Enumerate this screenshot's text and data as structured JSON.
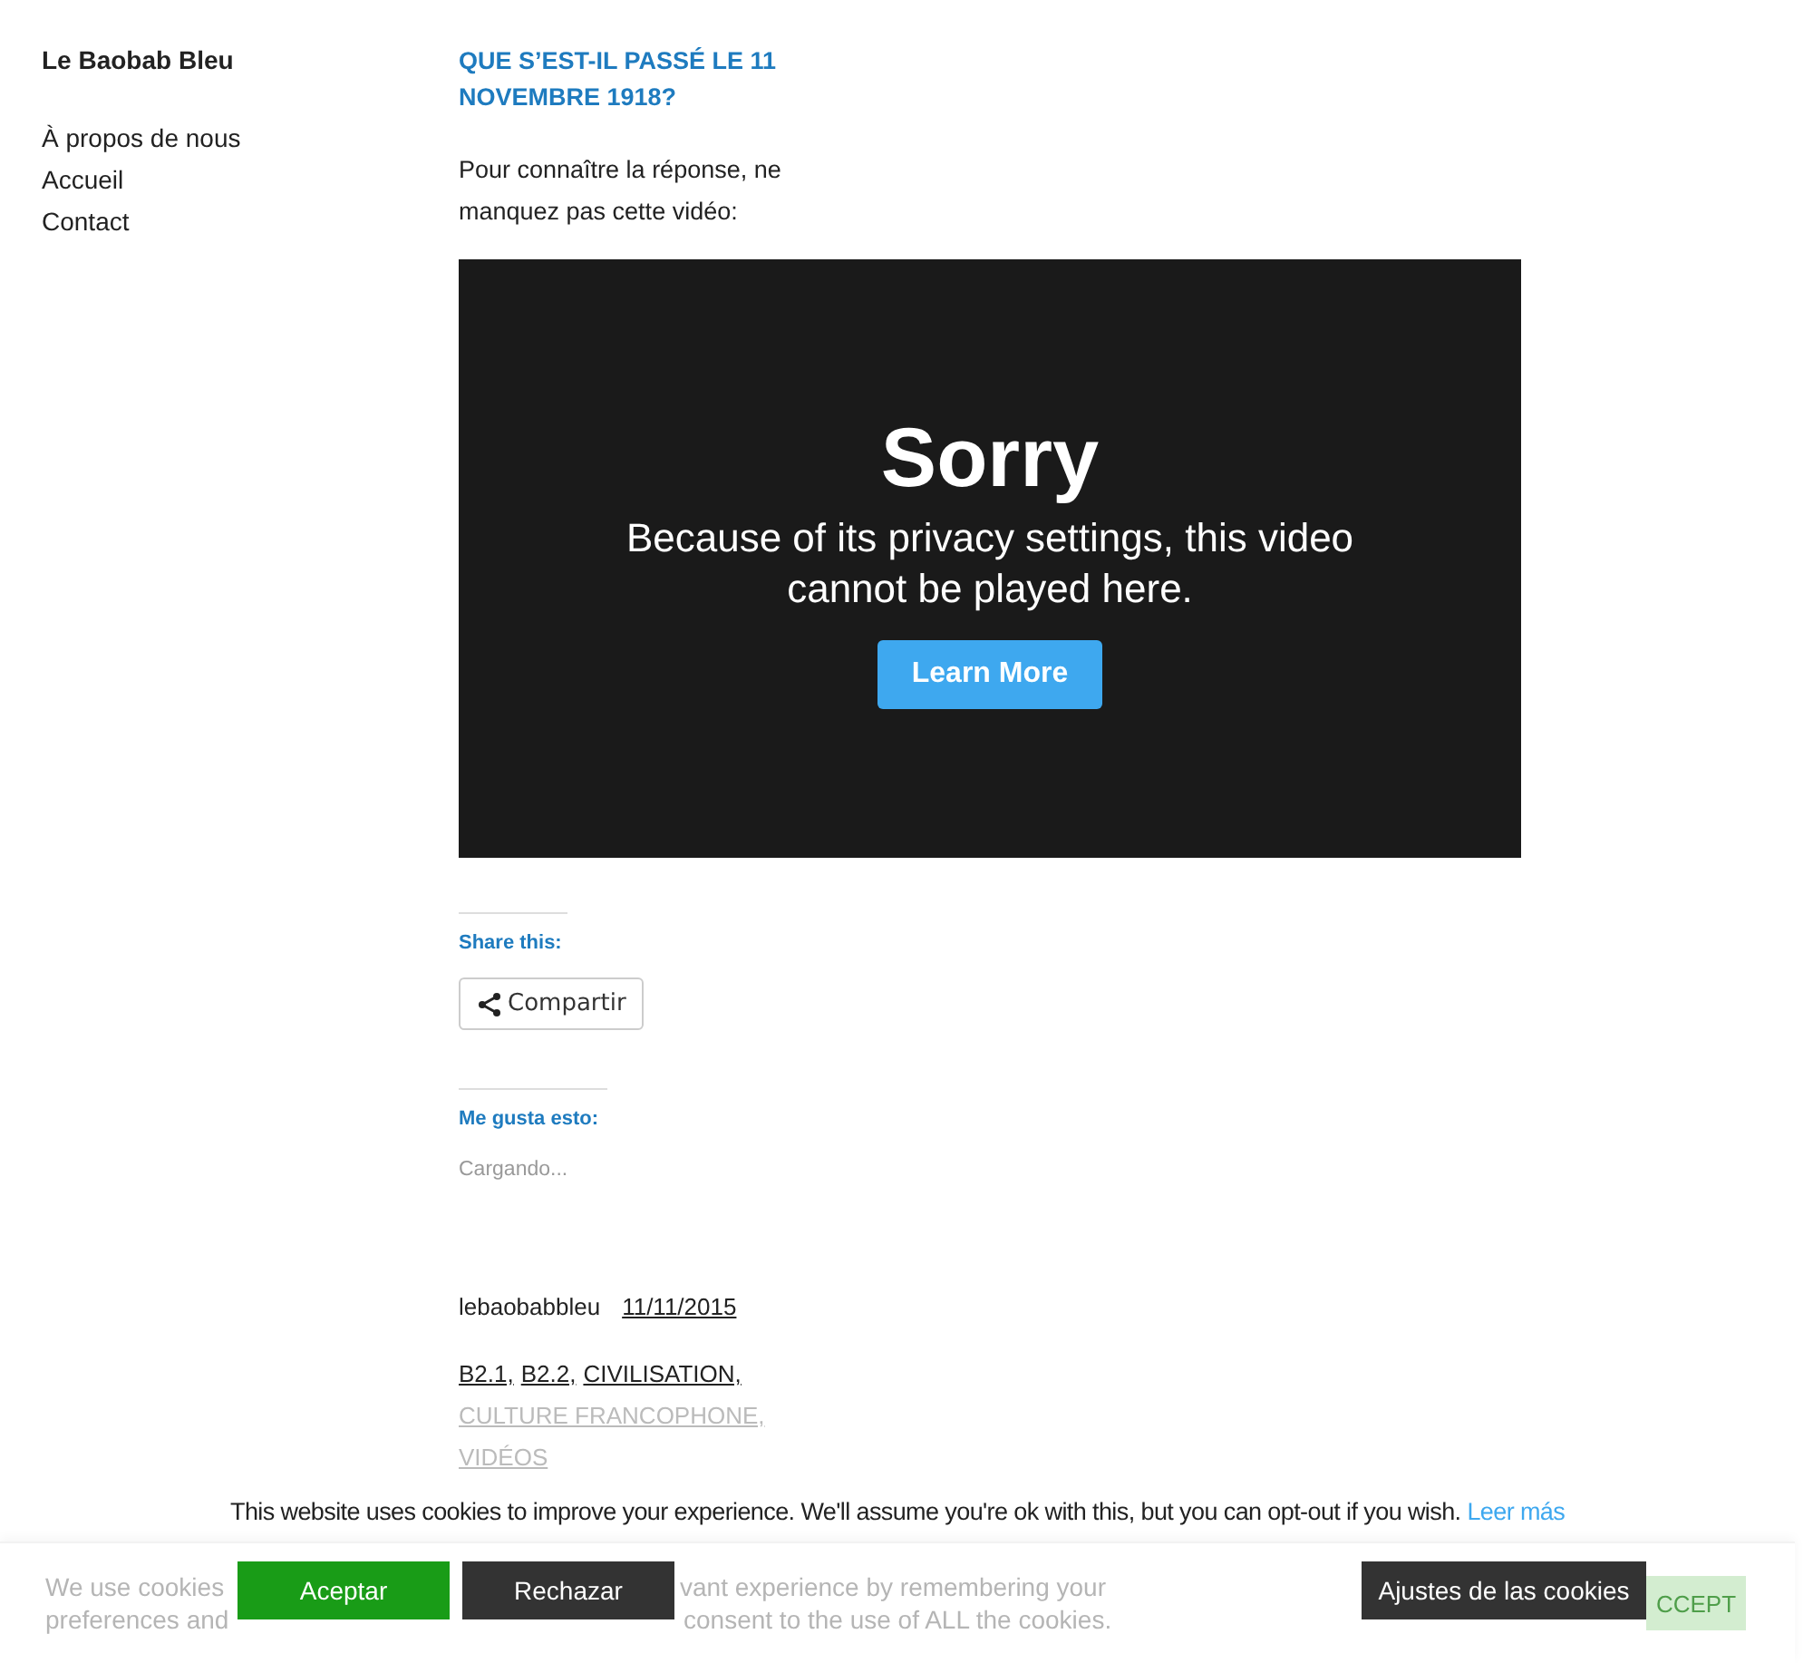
{
  "site_title": "Le Baobab Bleu",
  "nav": [
    {
      "label": "À propos de nous"
    },
    {
      "label": "Accueil"
    },
    {
      "label": "Contact"
    }
  ],
  "post": {
    "title": "QUE S’EST-IL PASSÉ LE 11 NOVEMBRE 1918?",
    "intro": "Pour connaître la réponse, ne manquez pas cette vidéo:",
    "video": {
      "heading": "Sorry",
      "message": "Because of its privacy settings, this video cannot be played here.",
      "button": "Learn More"
    },
    "share_heading": "Share this:",
    "share_button": "Compartir",
    "like_heading": "Me gusta esto:",
    "like_status": "Cargando...",
    "author": "lebaobabbleu",
    "date": "11/11/2015",
    "categories": [
      "B2.1,",
      "B2.2,",
      "CIVILISATION,",
      "CULTURE FRANCOPHONE,",
      "VIDÉOS"
    ]
  },
  "cookie_notice": {
    "text": "This website uses cookies to improve your experience. We'll assume you're ok with this, but you can opt-out if you wish.",
    "link": "Leer más",
    "accept": "Aceptar",
    "reject": "Rechazar",
    "settings": "Ajustes de las cookies"
  },
  "faded_banner": {
    "line_1": [
      "We use cookies",
      "vant experience by remembering your"
    ],
    "line_2": [
      "preferences and",
      "consent to the use of ALL the cookies."
    ],
    "button": "CCEPT"
  }
}
